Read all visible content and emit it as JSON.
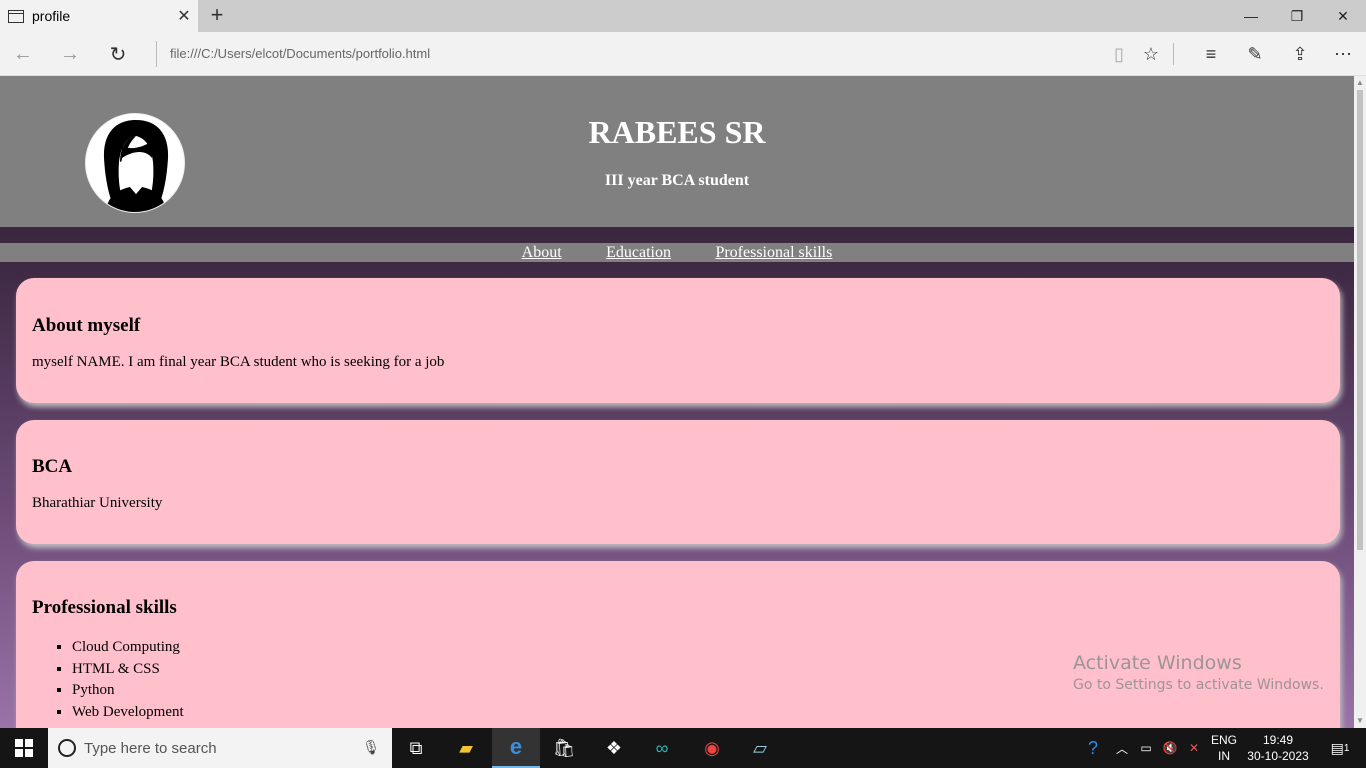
{
  "browser": {
    "tab_title": "profile",
    "address": "file:///C:/Users/elcot/Documents/portfolio.html"
  },
  "profile": {
    "name": "RABEES SR",
    "subtitle": "III year BCA student"
  },
  "nav": {
    "items": [
      "About",
      "Education",
      "Professional skills"
    ]
  },
  "sections": {
    "about": {
      "title": "About myself",
      "text": "myself NAME. I am final year BCA student who is seeking for a job"
    },
    "education": {
      "title": "BCA",
      "text": "Bharathiar University"
    },
    "skills": {
      "title": "Professional skills",
      "items": [
        "Cloud Computing",
        "HTML & CSS",
        "Python",
        "Web Development"
      ]
    }
  },
  "watermark": {
    "line1": "Activate Windows",
    "line2": "Go to Settings to activate Windows."
  },
  "taskbar": {
    "search_placeholder": "Type here to search",
    "language": "ENG",
    "region": "IN",
    "time": "19:49",
    "date": "30-10-2023",
    "notification_count": "1"
  },
  "colors": {
    "header_gray": "#808080",
    "card_pink": "#ffc0cb",
    "text_white": "#ffffff"
  }
}
